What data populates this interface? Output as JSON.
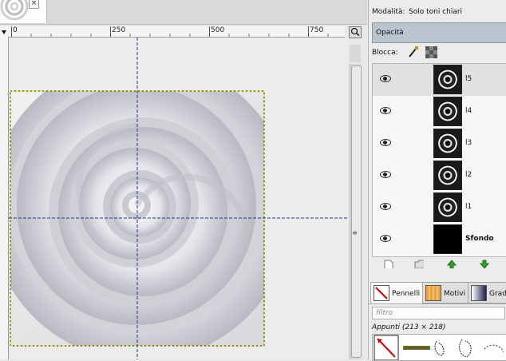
{
  "header": {
    "mode_label": "Modalità:",
    "mode_value": "Solo toni chiari",
    "opacity_label": "Opacità",
    "lock_label": "Blocca:"
  },
  "ruler": {
    "labels": [
      "0",
      "250",
      "500",
      "750"
    ]
  },
  "layers": [
    {
      "name": "l5",
      "selected": true,
      "bold": false
    },
    {
      "name": "l4",
      "selected": false,
      "bold": false
    },
    {
      "name": "l3",
      "selected": false,
      "bold": false
    },
    {
      "name": "l2",
      "selected": false,
      "bold": false
    },
    {
      "name": "l1",
      "selected": false,
      "bold": false
    },
    {
      "name": "Sfondo",
      "selected": false,
      "bold": true
    }
  ],
  "layer_buttons": [
    "new-layer-icon",
    "folder-icon",
    "raise-layer-icon",
    "lower-layer-icon"
  ],
  "brushes": {
    "tabs": [
      "Pennelli",
      "Motivi",
      "Gradi"
    ],
    "filter_placeholder": "filtro",
    "clipboard_label": "Appunti (213 × 218)"
  },
  "colors": {
    "selection_highlight": "#b9c4cf",
    "guide": "#1a3f8c",
    "raise_arrow": "#2fa12f"
  }
}
